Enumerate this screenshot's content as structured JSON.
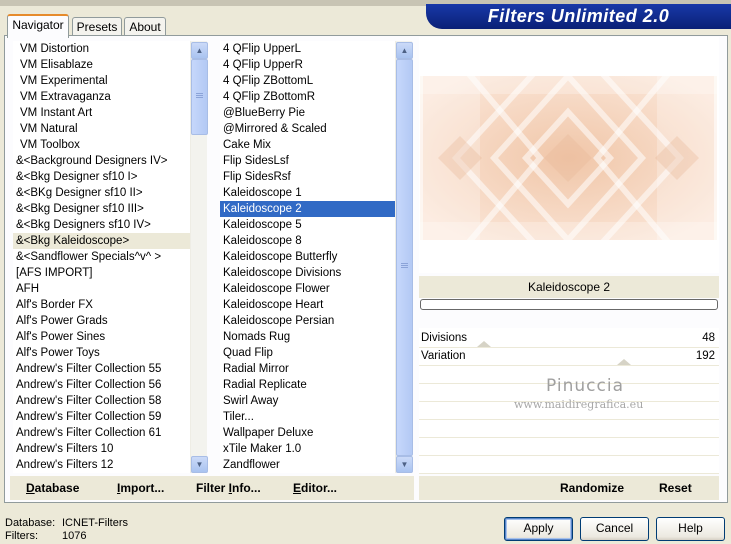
{
  "window": {
    "title": "Filters Unlimited 2.0"
  },
  "tabs": [
    {
      "label": "Navigator"
    },
    {
      "label": "Presets"
    },
    {
      "label": "About"
    }
  ],
  "categories": [
    "VM Distortion",
    "VM Elisablaze",
    "VM Experimental",
    "VM Extravaganza",
    "VM Instant Art",
    "VM Natural",
    "VM Toolbox",
    "&<Background Designers IV>",
    "&<Bkg Designer sf10 I>",
    "&<BKg Designer sf10 II>",
    "&<Bkg Designer sf10 III>",
    "&<Bkg Designers sf10 IV>",
    "&<Bkg Kaleidoscope>",
    "&<Sandflower Specials^v^ >",
    "[AFS IMPORT]",
    "AFH",
    "Alf's Border FX",
    "Alf's Power Grads",
    "Alf's Power Sines",
    "Alf's Power Toys",
    "Andrew's Filter Collection 55",
    "Andrew's Filter Collection 56",
    "Andrew's Filter Collection 58",
    "Andrew's Filter Collection 59",
    "Andrew's Filter Collection 61",
    "Andrew's Filters 10",
    "Andrew's Filters 12"
  ],
  "filters": [
    "4 QFlip UpperL",
    "4 QFlip UpperR",
    "4 QFlip ZBottomL",
    "4 QFlip ZBottomR",
    "@BlueBerry Pie",
    "@Mirrored & Scaled",
    "Cake Mix",
    "Flip SidesLsf",
    "Flip SidesRsf",
    "Kaleidoscope 1",
    "Kaleidoscope 2",
    "Kaleidoscope 5",
    "Kaleidoscope 8",
    "Kaleidoscope Butterfly",
    "Kaleidoscope Divisions",
    "Kaleidoscope Flower",
    "Kaleidoscope Heart",
    "Kaleidoscope Persian",
    "Nomads Rug",
    "Quad Flip",
    "Radial Mirror",
    "Radial Replicate",
    "Swirl Away",
    "Tiler...",
    "Wallpaper Deluxe",
    "xTile Maker 1.0",
    "Zandflower"
  ],
  "preview": {
    "filter_name": "Kaleidoscope 2"
  },
  "params": [
    {
      "label": "Divisions",
      "value": "48",
      "level": 0.19
    },
    {
      "label": "Variation",
      "value": "192",
      "level": 0.75
    }
  ],
  "watermark": {
    "title": "Pinuccia",
    "url": "www.maidiregrafica.eu"
  },
  "toolbar": [
    {
      "pre": "",
      "u": "D",
      "post": "atabase"
    },
    {
      "pre": "",
      "u": "I",
      "post": "mport..."
    },
    {
      "pre": "Filter ",
      "u": "I",
      "post": "nfo..."
    },
    {
      "pre": "",
      "u": "E",
      "post": "ditor..."
    }
  ],
  "randomize_label": "Randomize",
  "reset_label": "Reset",
  "status": {
    "database_label": "Database:",
    "database_value": "ICNET-Filters",
    "filters_label": "Filters:",
    "filters_value": "1076"
  },
  "buttons": {
    "apply": "Apply",
    "cancel": "Cancel",
    "help": "Help"
  },
  "colors": {
    "title_bar": "#0a2076",
    "selection": "#316ac5",
    "preview_base": "#f6d6c2",
    "active_tab": "#e68b2c"
  }
}
